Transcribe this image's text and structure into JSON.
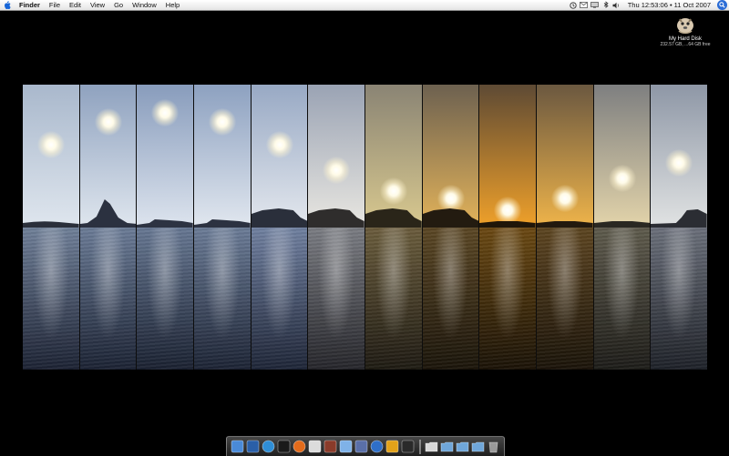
{
  "menubar": {
    "apple_icon": "apple-icon",
    "items": [
      "Finder",
      "File",
      "Edit",
      "View",
      "Go",
      "Window",
      "Help"
    ],
    "status_icons": [
      "time-machine-icon",
      "mail-icon",
      "display-icon",
      "bluetooth-icon",
      "volume-icon"
    ],
    "clock": "Thu 12:53:06 • 11 Oct 2007",
    "spotlight_icon": "spotlight-icon"
  },
  "desktop": {
    "disk": {
      "name": "My Hard Disk",
      "info": "232.57 GB, ...64 GB free"
    }
  },
  "wallpaper": {
    "panels": [
      {
        "sky_top": "#a9b8cc",
        "sky_bottom": "#dfe6ee",
        "sun_y": 0.42,
        "sun_x": 0.5,
        "water_top": "#6f7f98",
        "water_bottom": "#1c2233",
        "land": "#2a2f3a",
        "peak": "none"
      },
      {
        "sky_top": "#8fa2bf",
        "sky_bottom": "#dfe6ee",
        "sun_y": 0.26,
        "sun_x": 0.5,
        "water_top": "#6a7b96",
        "water_bottom": "#1b2233",
        "land": "#2b3140",
        "peak": "spire"
      },
      {
        "sky_top": "#889cbc",
        "sky_bottom": "#dde4ee",
        "sun_y": 0.2,
        "sun_x": 0.5,
        "water_top": "#667792",
        "water_bottom": "#1a2131",
        "land": "#2d3342",
        "peak": "low"
      },
      {
        "sky_top": "#8da1c0",
        "sky_bottom": "#e1e7ef",
        "sun_y": 0.26,
        "sun_x": 0.5,
        "water_top": "#6a7b96",
        "water_bottom": "#1c2334",
        "land": "#2c3241",
        "peak": "low"
      },
      {
        "sky_top": "#98a9c4",
        "sky_bottom": "#e4e8ee",
        "sun_y": 0.42,
        "sun_x": 0.5,
        "water_top": "#7080a0",
        "water_bottom": "#1e2537",
        "land": "#2a2f3b",
        "peak": "mesa"
      },
      {
        "sky_top": "#9aa3b4",
        "sky_bottom": "#e9e7e1",
        "sun_y": 0.6,
        "sun_x": 0.5,
        "water_top": "#7a7c82",
        "water_bottom": "#25252a",
        "land": "#2f2d2c",
        "peak": "mesa"
      },
      {
        "sky_top": "#8a8474",
        "sky_bottom": "#d9c98f",
        "sun_y": 0.75,
        "sun_x": 0.5,
        "water_top": "#6a5c3c",
        "water_bottom": "#1e1a12",
        "land": "#2a2519",
        "peak": "mesa"
      },
      {
        "sky_top": "#6d6150",
        "sky_bottom": "#e3b35a",
        "sun_y": 0.8,
        "sun_x": 0.5,
        "water_top": "#5a4624",
        "water_bottom": "#1a140a",
        "land": "#231b10",
        "peak": "mesa"
      },
      {
        "sky_top": "#5e4a34",
        "sky_bottom": "#f0a12a",
        "sun_y": 0.88,
        "sun_x": 0.5,
        "water_top": "#6a4812",
        "water_bottom": "#1a1206",
        "land": "#1f1609",
        "peak": "flat"
      },
      {
        "sky_top": "#6b5840",
        "sky_bottom": "#efb44a",
        "sun_y": 0.8,
        "sun_x": 0.5,
        "water_top": "#5c4420",
        "water_bottom": "#1a1309",
        "land": "#22190e",
        "peak": "flat"
      },
      {
        "sky_top": "#7e7f80",
        "sky_bottom": "#e3d4aa",
        "sun_y": 0.66,
        "sun_x": 0.5,
        "water_top": "#5e5a4c",
        "water_bottom": "#1d1c18",
        "land": "#2a2822",
        "peak": "flat"
      },
      {
        "sky_top": "#8e97a6",
        "sky_bottom": "#e1e3e3",
        "sun_y": 0.55,
        "sun_x": 0.5,
        "water_top": "#6a6f7a",
        "water_bottom": "#1e2128",
        "land": "#2b2d33",
        "peak": "mesa-right"
      }
    ]
  },
  "dock": {
    "apps": [
      "finder-icon",
      "dashboard-icon",
      "safari-icon",
      "terminal-icon",
      "firefox-icon",
      "x11-icon",
      "script-editor-icon",
      "ichat-icon",
      "automator-icon",
      "itunes-icon",
      "xcode-icon",
      "quicksilver-icon"
    ],
    "folders": [
      "home-folder-icon",
      "applications-folder-icon",
      "documents-folder-icon",
      "downloads-folder-icon",
      "trash-icon"
    ],
    "app_colors": [
      "#4a8ad8",
      "#2a5fa8",
      "#2f8ed6",
      "#1a1a1a",
      "#e36b1b",
      "#dcdcdc",
      "#8a3b2a",
      "#7fb2e8",
      "#5a6fa8",
      "#2f6fc8",
      "#e2a21a",
      "#2a2a2a"
    ],
    "folder_colors": [
      "#d9d9d9",
      "#6fa6d9",
      "#6fa6d9",
      "#6fa6d9",
      "#9a9a9a"
    ]
  }
}
